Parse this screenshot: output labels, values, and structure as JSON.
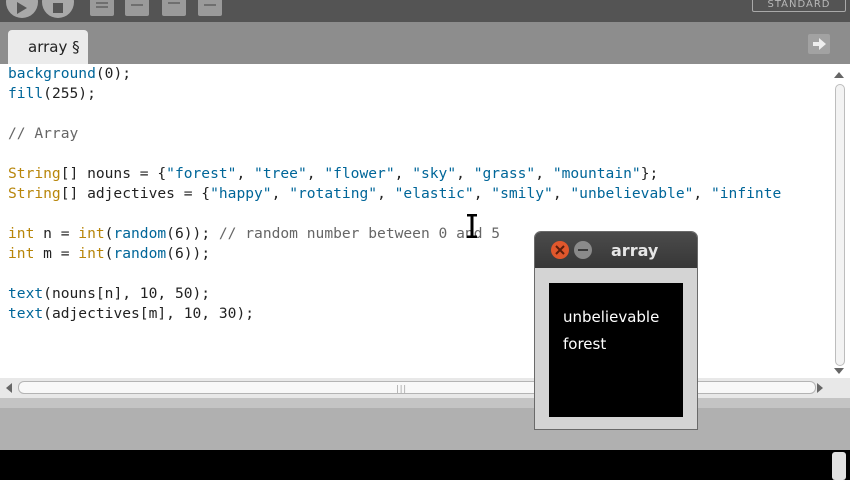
{
  "toolbar": {
    "mode": "STANDARD",
    "icons": [
      "run-icon",
      "stop-icon",
      "new-icon",
      "open-icon",
      "save-icon",
      "export-icon"
    ]
  },
  "tabs": [
    {
      "label": "array §"
    }
  ],
  "editor": {
    "lines": [
      {
        "segments": [
          [
            "fn",
            "background"
          ],
          [
            "p",
            "(0);"
          ]
        ]
      },
      {
        "segments": [
          [
            "fn",
            "fill"
          ],
          [
            "p",
            "(255);"
          ]
        ]
      },
      {
        "segments": []
      },
      {
        "segments": [
          [
            "cm",
            "// Array"
          ]
        ]
      },
      {
        "segments": []
      },
      {
        "segments": [
          [
            "kw",
            "String"
          ],
          [
            "p",
            "[] nouns = {"
          ],
          [
            "str",
            "\"forest\""
          ],
          [
            "p",
            ", "
          ],
          [
            "str",
            "\"tree\""
          ],
          [
            "p",
            ", "
          ],
          [
            "str",
            "\"flower\""
          ],
          [
            "p",
            ", "
          ],
          [
            "str",
            "\"sky\""
          ],
          [
            "p",
            ", "
          ],
          [
            "str",
            "\"grass\""
          ],
          [
            "p",
            ", "
          ],
          [
            "str",
            "\"mountain\""
          ],
          [
            "p",
            "};"
          ]
        ]
      },
      {
        "segments": [
          [
            "kw",
            "String"
          ],
          [
            "p",
            "[] adjectives = {"
          ],
          [
            "str",
            "\"happy\""
          ],
          [
            "p",
            ", "
          ],
          [
            "str",
            "\"rotating\""
          ],
          [
            "p",
            ", "
          ],
          [
            "str",
            "\"elastic\""
          ],
          [
            "p",
            ", "
          ],
          [
            "str",
            "\"smily\""
          ],
          [
            "p",
            ", "
          ],
          [
            "str",
            "\"unbelievable\""
          ],
          [
            "p",
            ", "
          ],
          [
            "str",
            "\"infinte"
          ]
        ]
      },
      {
        "segments": []
      },
      {
        "segments": [
          [
            "kw",
            "int"
          ],
          [
            "p",
            " n = "
          ],
          [
            "kw",
            "int"
          ],
          [
            "p",
            "("
          ],
          [
            "fn",
            "random"
          ],
          [
            "p",
            "(6)); "
          ],
          [
            "cm",
            "// random number between 0 and 5"
          ]
        ]
      },
      {
        "segments": [
          [
            "kw",
            "int"
          ],
          [
            "p",
            " m = "
          ],
          [
            "kw",
            "int"
          ],
          [
            "p",
            "("
          ],
          [
            "fn",
            "random"
          ],
          [
            "p",
            "(6));"
          ]
        ]
      },
      {
        "segments": []
      },
      {
        "segments": [
          [
            "fn",
            "text"
          ],
          [
            "p",
            "(nouns[n], 10, 50);"
          ]
        ]
      },
      {
        "segments": [
          [
            "fn",
            "text"
          ],
          [
            "p",
            "(adjectives[m], 10, 30);"
          ]
        ]
      }
    ]
  },
  "sketch_window": {
    "title": "array",
    "output_line1": "unbelievable",
    "output_line2": "forest"
  },
  "colors": {
    "toolbar_bg": "#545454",
    "tabbar_bg": "#8d8d8d",
    "keyword": "#b8860b",
    "function": "#006699",
    "string": "#006699",
    "comment": "#666666",
    "close_button": "#e0572c"
  }
}
